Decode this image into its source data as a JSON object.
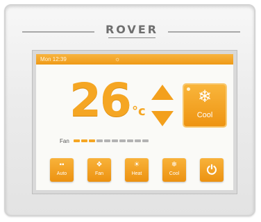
{
  "brand": "ROVER",
  "status_bar": {
    "time": "Mon 12:39",
    "icon": "sun-icon"
  },
  "temperature": {
    "value": "26",
    "unit": "°c"
  },
  "mode_tile": {
    "label": "Cool",
    "icon": "snowflake-icon"
  },
  "fan": {
    "label": "Fan",
    "level": 0.3
  },
  "buttons": {
    "auto": {
      "label": "Auto",
      "icon": "grid-icon"
    },
    "fan": {
      "label": "Fan",
      "icon": "fan-icon"
    },
    "heat": {
      "label": "Heat",
      "icon": "heat-icon"
    },
    "cool": {
      "label": "Cool",
      "icon": "snowflake-icon"
    },
    "power": {
      "icon": "power-icon"
    }
  },
  "colors": {
    "accent": "#f5a623",
    "accent_dark": "#ec9211",
    "fan_inactive": "#b3b3b3"
  }
}
